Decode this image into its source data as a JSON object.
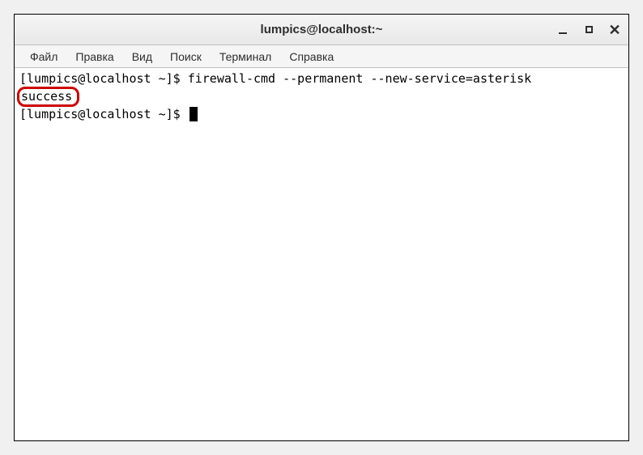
{
  "window": {
    "title": "lumpics@localhost:~"
  },
  "menubar": {
    "items": [
      "Файл",
      "Правка",
      "Вид",
      "Поиск",
      "Терминал",
      "Справка"
    ]
  },
  "terminal": {
    "line1_prompt": "[lumpics@localhost ~]$ ",
    "line1_command": "firewall-cmd --permanent --new-service=asterisk",
    "line2_output": "success",
    "line3_prompt": "[lumpics@localhost ~]$ "
  }
}
